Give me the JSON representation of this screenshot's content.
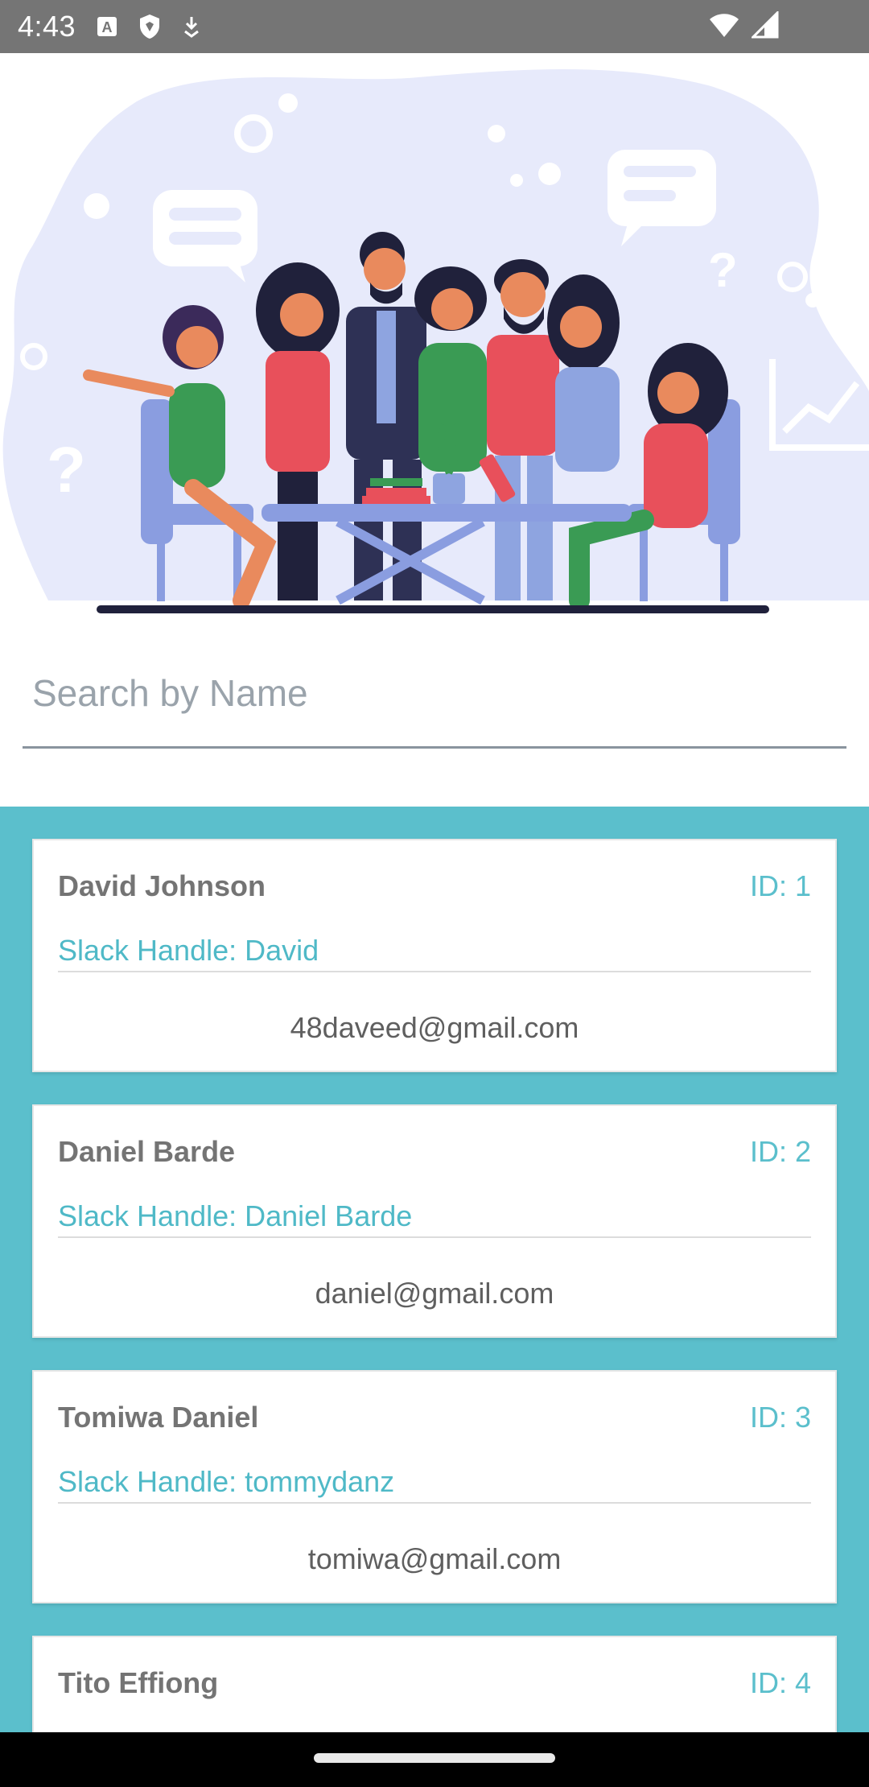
{
  "status_bar": {
    "time": "4:43",
    "icons": [
      "a-box-icon",
      "shield-icon",
      "download-arrow-icon",
      "wifi-icon",
      "signal-icon"
    ]
  },
  "hero": {
    "illustration": "team-illustration"
  },
  "search": {
    "placeholder": "Search by Name",
    "value": ""
  },
  "colors": {
    "accent": "#5bbfcc",
    "status_bar": "#757575",
    "name_text": "#747474",
    "email_text": "#5f5f5f"
  },
  "contacts": [
    {
      "name": "David Johnson",
      "id": "ID: 1",
      "slack": "Slack Handle: David",
      "email": "48daveed@gmail.com"
    },
    {
      "name": "Daniel Barde",
      "id": "ID: 2",
      "slack": "Slack Handle: Daniel Barde",
      "email": "daniel@gmail.com"
    },
    {
      "name": "Tomiwa Daniel",
      "id": "ID: 3",
      "slack": "Slack Handle: tommydanz",
      "email": "tomiwa@gmail.com"
    },
    {
      "name": "Tito Effiong",
      "id": "ID: 4",
      "slack": "",
      "email": ""
    }
  ]
}
